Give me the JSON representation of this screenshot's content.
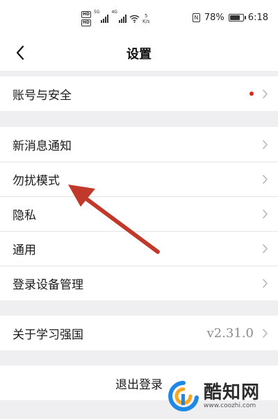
{
  "status_bar": {
    "hd_top": "HD",
    "hd_bottom": "HD",
    "net_1": "5G",
    "net_2": "4G",
    "speed_value": "5",
    "speed_unit": "K/s",
    "nfc": "N",
    "battery_percent": "78%",
    "battery_level": 0.78,
    "time": "6:18"
  },
  "header": {
    "title": "设置",
    "back_icon": "chevron-left-icon"
  },
  "groups": [
    {
      "items": [
        {
          "label": "账号与安全",
          "badge": "red-dot",
          "icon": "chevron-right-icon"
        }
      ]
    },
    {
      "items": [
        {
          "label": "新消息通知",
          "icon": "chevron-right-icon"
        },
        {
          "label": "勿扰模式",
          "icon": "chevron-right-icon"
        },
        {
          "label": "隐私",
          "icon": "chevron-right-icon"
        },
        {
          "label": "通用",
          "icon": "chevron-right-icon"
        },
        {
          "label": "登录设备管理",
          "icon": "chevron-right-icon"
        }
      ]
    },
    {
      "items": [
        {
          "label": "关于学习强国",
          "value": "v2.31.0",
          "icon": "chevron-right-icon"
        }
      ]
    }
  ],
  "logout": {
    "label": "退出登录"
  },
  "annotation": {
    "color": "#c0392b",
    "icon": "red-arrow"
  },
  "watermark": {
    "brand": "酷知网",
    "url": "www.coozhi.com",
    "logo_colors": [
      "#1e88e5",
      "#f5a623"
    ]
  },
  "colors": {
    "background": "#efeff1",
    "surface": "#ffffff",
    "divider": "#e4e4e6",
    "chevron": "#b5b5b8",
    "badge": "#d9271c"
  }
}
